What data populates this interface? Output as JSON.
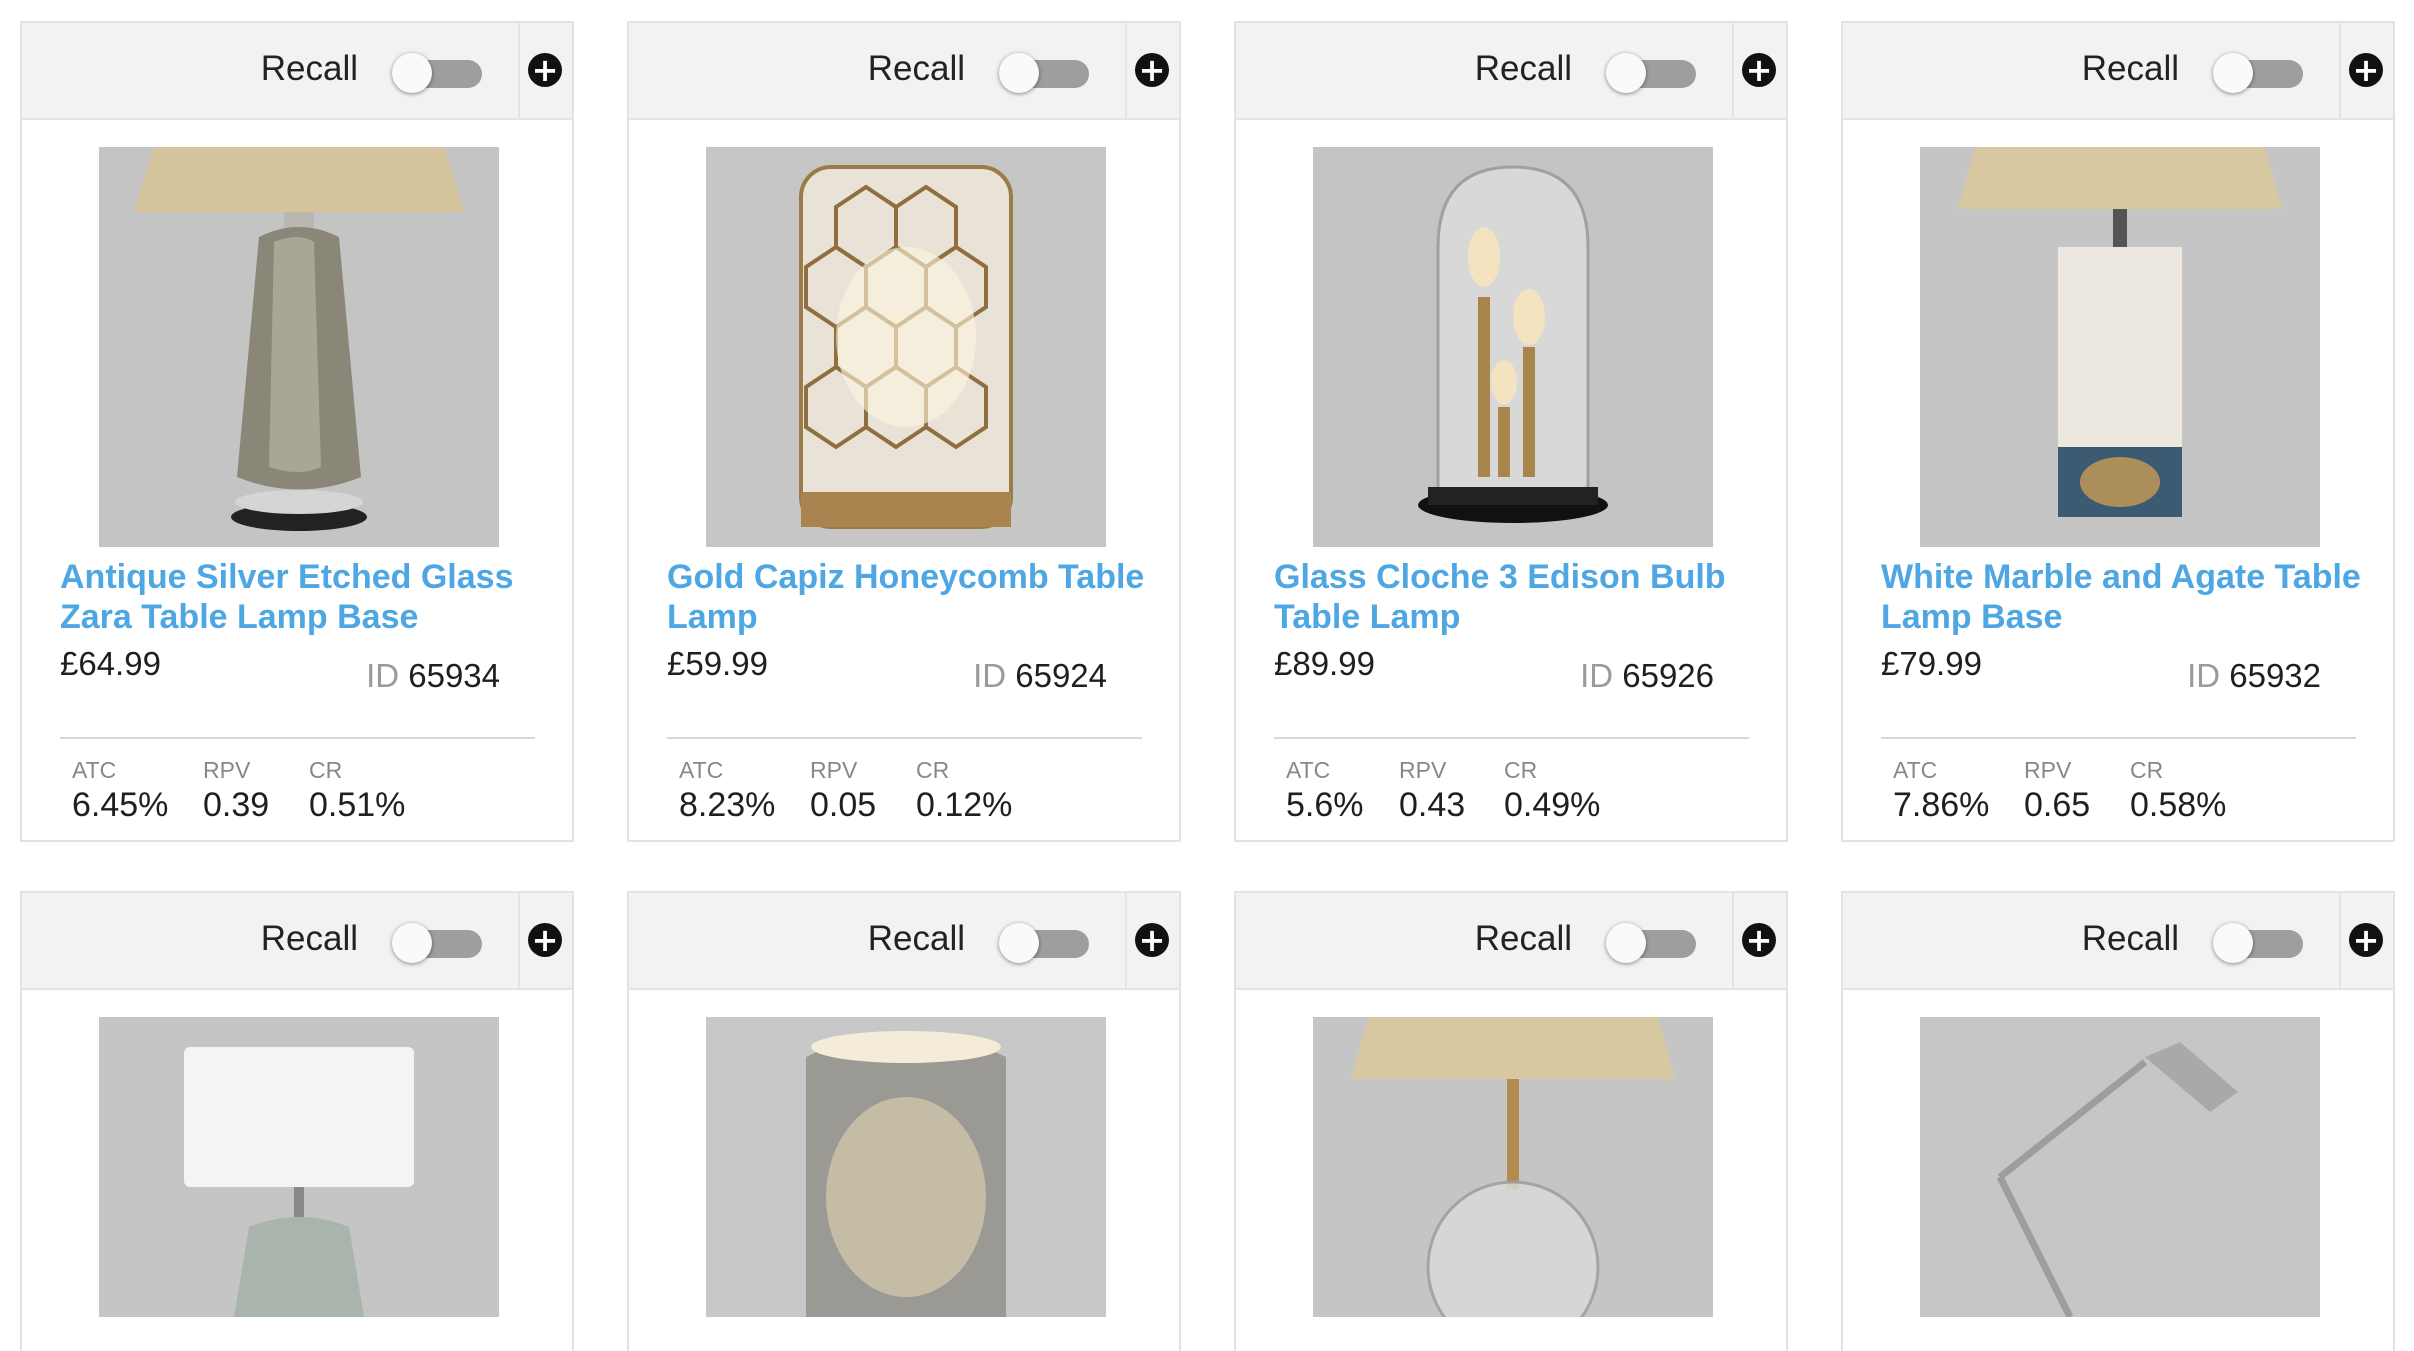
{
  "cards": [
    {
      "recall_label": "Recall",
      "title": "Antique Silver Etched Glass Zara Table Lamp Base",
      "price": "£64.99",
      "id_label": "ID",
      "id_value": "65934",
      "stats": [
        {
          "label": "ATC",
          "value": "6.45%"
        },
        {
          "label": "RPV",
          "value": "0.39"
        },
        {
          "label": "CR",
          "value": "0.51%"
        }
      ]
    },
    {
      "recall_label": "Recall",
      "title": "Gold Capiz Honeycomb Table Lamp",
      "price": "£59.99",
      "id_label": "ID",
      "id_value": "65924",
      "stats": [
        {
          "label": "ATC",
          "value": "8.23%"
        },
        {
          "label": "RPV",
          "value": "0.05"
        },
        {
          "label": "CR",
          "value": "0.12%"
        }
      ]
    },
    {
      "recall_label": "Recall",
      "title": "Glass Cloche 3 Edison Bulb Table Lamp",
      "price": "£89.99",
      "id_label": "ID",
      "id_value": "65926",
      "stats": [
        {
          "label": "ATC",
          "value": "5.6%"
        },
        {
          "label": "RPV",
          "value": "0.43"
        },
        {
          "label": "CR",
          "value": "0.49%"
        }
      ]
    },
    {
      "recall_label": "Recall",
      "title": "White Marble and Agate Table Lamp Base",
      "price": "£79.99",
      "id_label": "ID",
      "id_value": "65932",
      "stats": [
        {
          "label": "ATC",
          "value": "7.86%"
        },
        {
          "label": "RPV",
          "value": "0.65"
        },
        {
          "label": "CR",
          "value": "0.58%"
        }
      ]
    },
    {
      "recall_label": "Recall"
    },
    {
      "recall_label": "Recall"
    },
    {
      "recall_label": "Recall"
    },
    {
      "recall_label": "Recall"
    }
  ],
  "recall_enabled": false,
  "icons": {
    "add": "plus-circle-icon"
  },
  "colors": {
    "title_link": "#4ea7e3",
    "toggle_track_off": "#9e9e9e",
    "header_bg": "#f2f2f2"
  }
}
